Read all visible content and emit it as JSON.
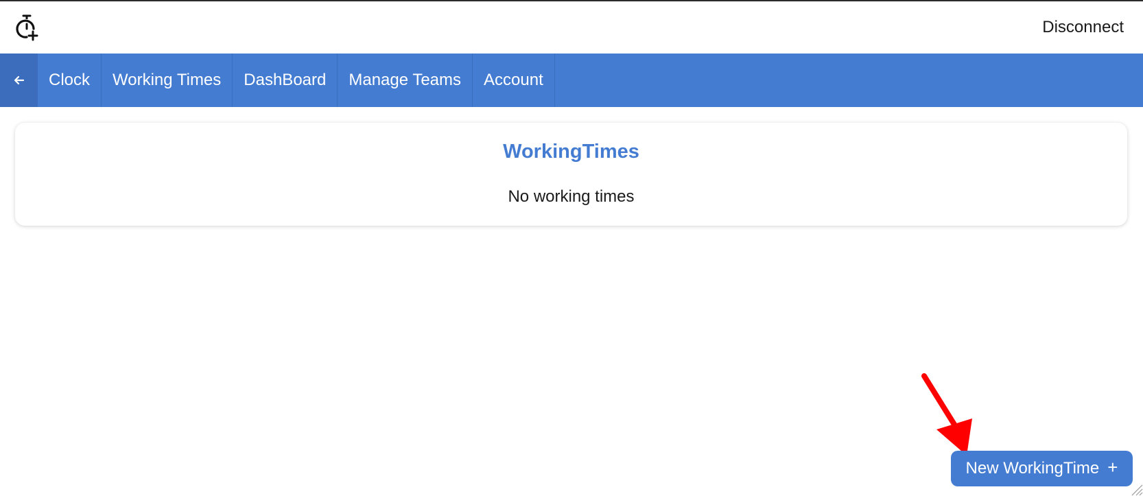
{
  "header": {
    "logo_icon": "stopwatch-plus-icon",
    "disconnect_label": "Disconnect"
  },
  "nav": {
    "back_icon": "arrow-left-icon",
    "items": [
      {
        "label": "Clock"
      },
      {
        "label": "Working Times"
      },
      {
        "label": "DashBoard"
      },
      {
        "label": "Manage Teams"
      },
      {
        "label": "Account"
      }
    ]
  },
  "main": {
    "card_title": "WorkingTimes",
    "empty_message": "No working times"
  },
  "actions": {
    "new_button_label": "New WorkingTime",
    "new_button_icon": "plus-icon",
    "new_button_icon_glyph": "+"
  },
  "annotation": {
    "arrow_color": "#ff0000"
  },
  "colors": {
    "primary": "#447cd2",
    "nav_back_bg": "#3c6dbd"
  }
}
